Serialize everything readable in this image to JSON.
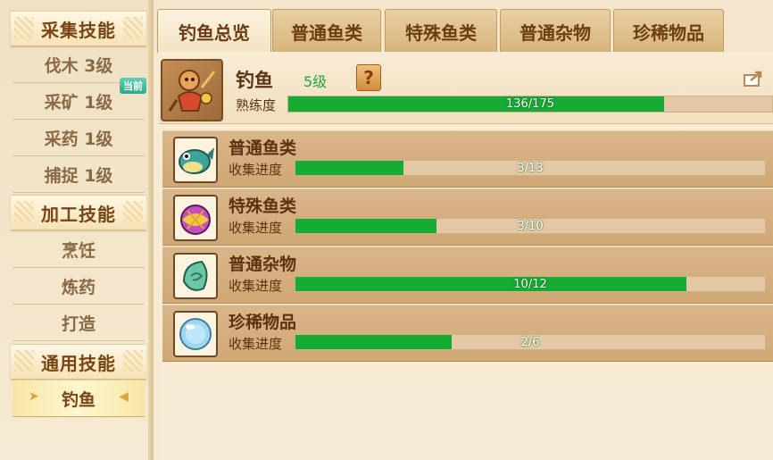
{
  "sidebar": {
    "sections": [
      {
        "title": "采集技能",
        "items": [
          {
            "label": "伐木 3级",
            "badge": ""
          },
          {
            "label": "采矿 1级",
            "badge": "当前"
          },
          {
            "label": "采药 1级",
            "badge": ""
          },
          {
            "label": "捕捉 1级",
            "badge": ""
          }
        ]
      },
      {
        "title": "加工技能",
        "items": [
          {
            "label": "烹饪"
          },
          {
            "label": "炼药"
          },
          {
            "label": "打造"
          }
        ]
      },
      {
        "title": "通用技能",
        "items": [
          {
            "label": "钓鱼",
            "active": true
          }
        ]
      }
    ]
  },
  "tabs": [
    {
      "label": "钓鱼总览",
      "active": true
    },
    {
      "label": "普通鱼类"
    },
    {
      "label": "特殊鱼类"
    },
    {
      "label": "普通杂物"
    },
    {
      "label": "珍稀物品"
    }
  ],
  "skill": {
    "name": "钓鱼",
    "level": "5级",
    "help": "?",
    "proficiency_label": "熟练度",
    "proficiency_text": "136/175",
    "proficiency_current": 136,
    "proficiency_max": 175
  },
  "categories": [
    {
      "name": "普通鱼类",
      "progress_label": "收集进度",
      "text": "3/13",
      "current": 3,
      "max": 13,
      "icon": "fish-icon"
    },
    {
      "name": "特殊鱼类",
      "progress_label": "收集进度",
      "text": "3/10",
      "current": 3,
      "max": 10,
      "icon": "special-fish-icon"
    },
    {
      "name": "普通杂物",
      "progress_label": "收集进度",
      "text": "10/12",
      "current": 10,
      "max": 12,
      "icon": "jade-icon"
    },
    {
      "name": "珍稀物品",
      "progress_label": "收集进度",
      "text": "2/6",
      "current": 2,
      "max": 6,
      "icon": "pearl-icon"
    }
  ],
  "colors": {
    "progress_fill": "#16ac33",
    "level_green": "#26a53a",
    "title_brown": "#7a4515"
  }
}
